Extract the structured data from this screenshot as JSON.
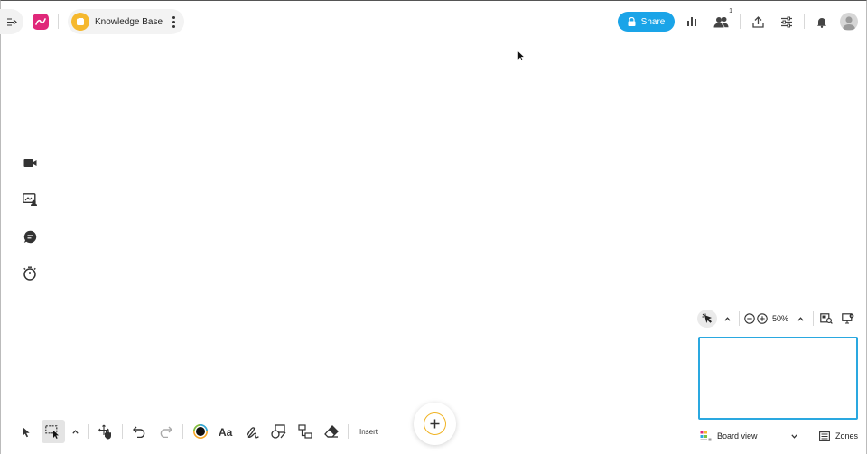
{
  "board": {
    "title": "Knowledge Base"
  },
  "header": {
    "share_label": "Share",
    "collaborators_count": "1",
    "accent_color": "#1aa4e8",
    "logo_color": "#e0287a",
    "board_icon_color": "#f5b82e"
  },
  "side_tools": [
    {
      "name": "video-icon"
    },
    {
      "name": "screen-share-icon"
    },
    {
      "name": "chat-icon"
    },
    {
      "name": "timer-icon"
    }
  ],
  "toolbar": {
    "insert_label": "Insert"
  },
  "navigator": {
    "zoom_label": "50%",
    "view_label": "Board view",
    "zones_label": "Zones",
    "minimap_border_color": "#2aa8e0"
  }
}
